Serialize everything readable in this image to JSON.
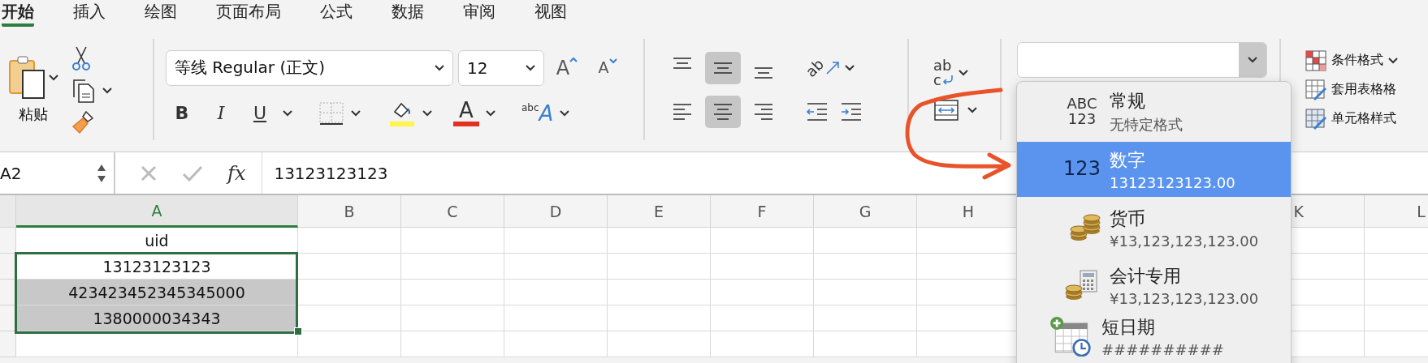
{
  "tabs": [
    {
      "label": "开始",
      "selected": true
    },
    {
      "label": "插入",
      "selected": false
    },
    {
      "label": "绘图",
      "selected": false
    },
    {
      "label": "页面布局",
      "selected": false
    },
    {
      "label": "公式",
      "selected": false
    },
    {
      "label": "数据",
      "selected": false
    },
    {
      "label": "审阅",
      "selected": false
    },
    {
      "label": "视图",
      "selected": false
    }
  ],
  "ribbon": {
    "paste_label": "粘贴",
    "font_name": "等线 Regular (正文)",
    "font_size": "12",
    "grow_glyph": "A",
    "shrink_glyph": "A",
    "style_buttons": [
      {
        "kind": "bold",
        "text": "B"
      },
      {
        "kind": "italic",
        "text": "I"
      },
      {
        "kind": "underline",
        "text": "U"
      }
    ],
    "font_color_glyph": "A",
    "effects_glyphs": [
      "abc",
      "A"
    ],
    "orientation_glyph": "ab",
    "wrap_glyphs": [
      "ab",
      "c"
    ],
    "vertical_align": [
      {
        "kind": "top",
        "selected": false
      },
      {
        "kind": "middle",
        "selected": true
      },
      {
        "kind": "bottom",
        "selected": false
      }
    ],
    "horizontal_align": [
      {
        "kind": "left",
        "selected": false
      },
      {
        "kind": "center",
        "selected": true
      },
      {
        "kind": "right",
        "selected": false
      }
    ],
    "styles": [
      {
        "kind": "conditional",
        "label": "条件格式"
      },
      {
        "kind": "table",
        "label": "套用表格格"
      },
      {
        "kind": "cell",
        "label": "单元格样式"
      }
    ]
  },
  "formula_bar": {
    "cell": "A2",
    "fx": "fx",
    "value": "13123123123"
  },
  "sheet": {
    "columns": [
      {
        "label": "A",
        "selected": true
      },
      {
        "label": "B",
        "selected": false
      },
      {
        "label": "C",
        "selected": false
      },
      {
        "label": "D",
        "selected": false
      },
      {
        "label": "E",
        "selected": false
      },
      {
        "label": "F",
        "selected": false
      },
      {
        "label": "G",
        "selected": false
      },
      {
        "label": "H",
        "selected": false
      },
      {
        "label": "K",
        "selected": false
      },
      {
        "label": "L",
        "selected": false
      }
    ],
    "rows": [
      {
        "value": "uid",
        "selected": false
      },
      {
        "value": "13123123123",
        "selected": true
      },
      {
        "value": "423423452345345000",
        "selected": true
      },
      {
        "value": "1380000034343",
        "selected": true
      },
      {
        "selected": false
      }
    ]
  },
  "format_menu": [
    {
      "kind": "general",
      "icon_text": [
        "ABC",
        "123"
      ],
      "name": "常规",
      "example": "无特定格式",
      "selected": false
    },
    {
      "kind": "number",
      "icon_text": [
        "123"
      ],
      "name": "数字",
      "example": "13123123123.00",
      "selected": true
    },
    {
      "kind": "currency",
      "name": "货币",
      "example": "¥13,123,123,123.00",
      "selected": false
    },
    {
      "kind": "accounting",
      "name": "会计专用",
      "example": "¥13,123,123,123.00",
      "selected": false
    },
    {
      "kind": "date",
      "name": "短日期",
      "example": "##########",
      "selected": false
    }
  ]
}
